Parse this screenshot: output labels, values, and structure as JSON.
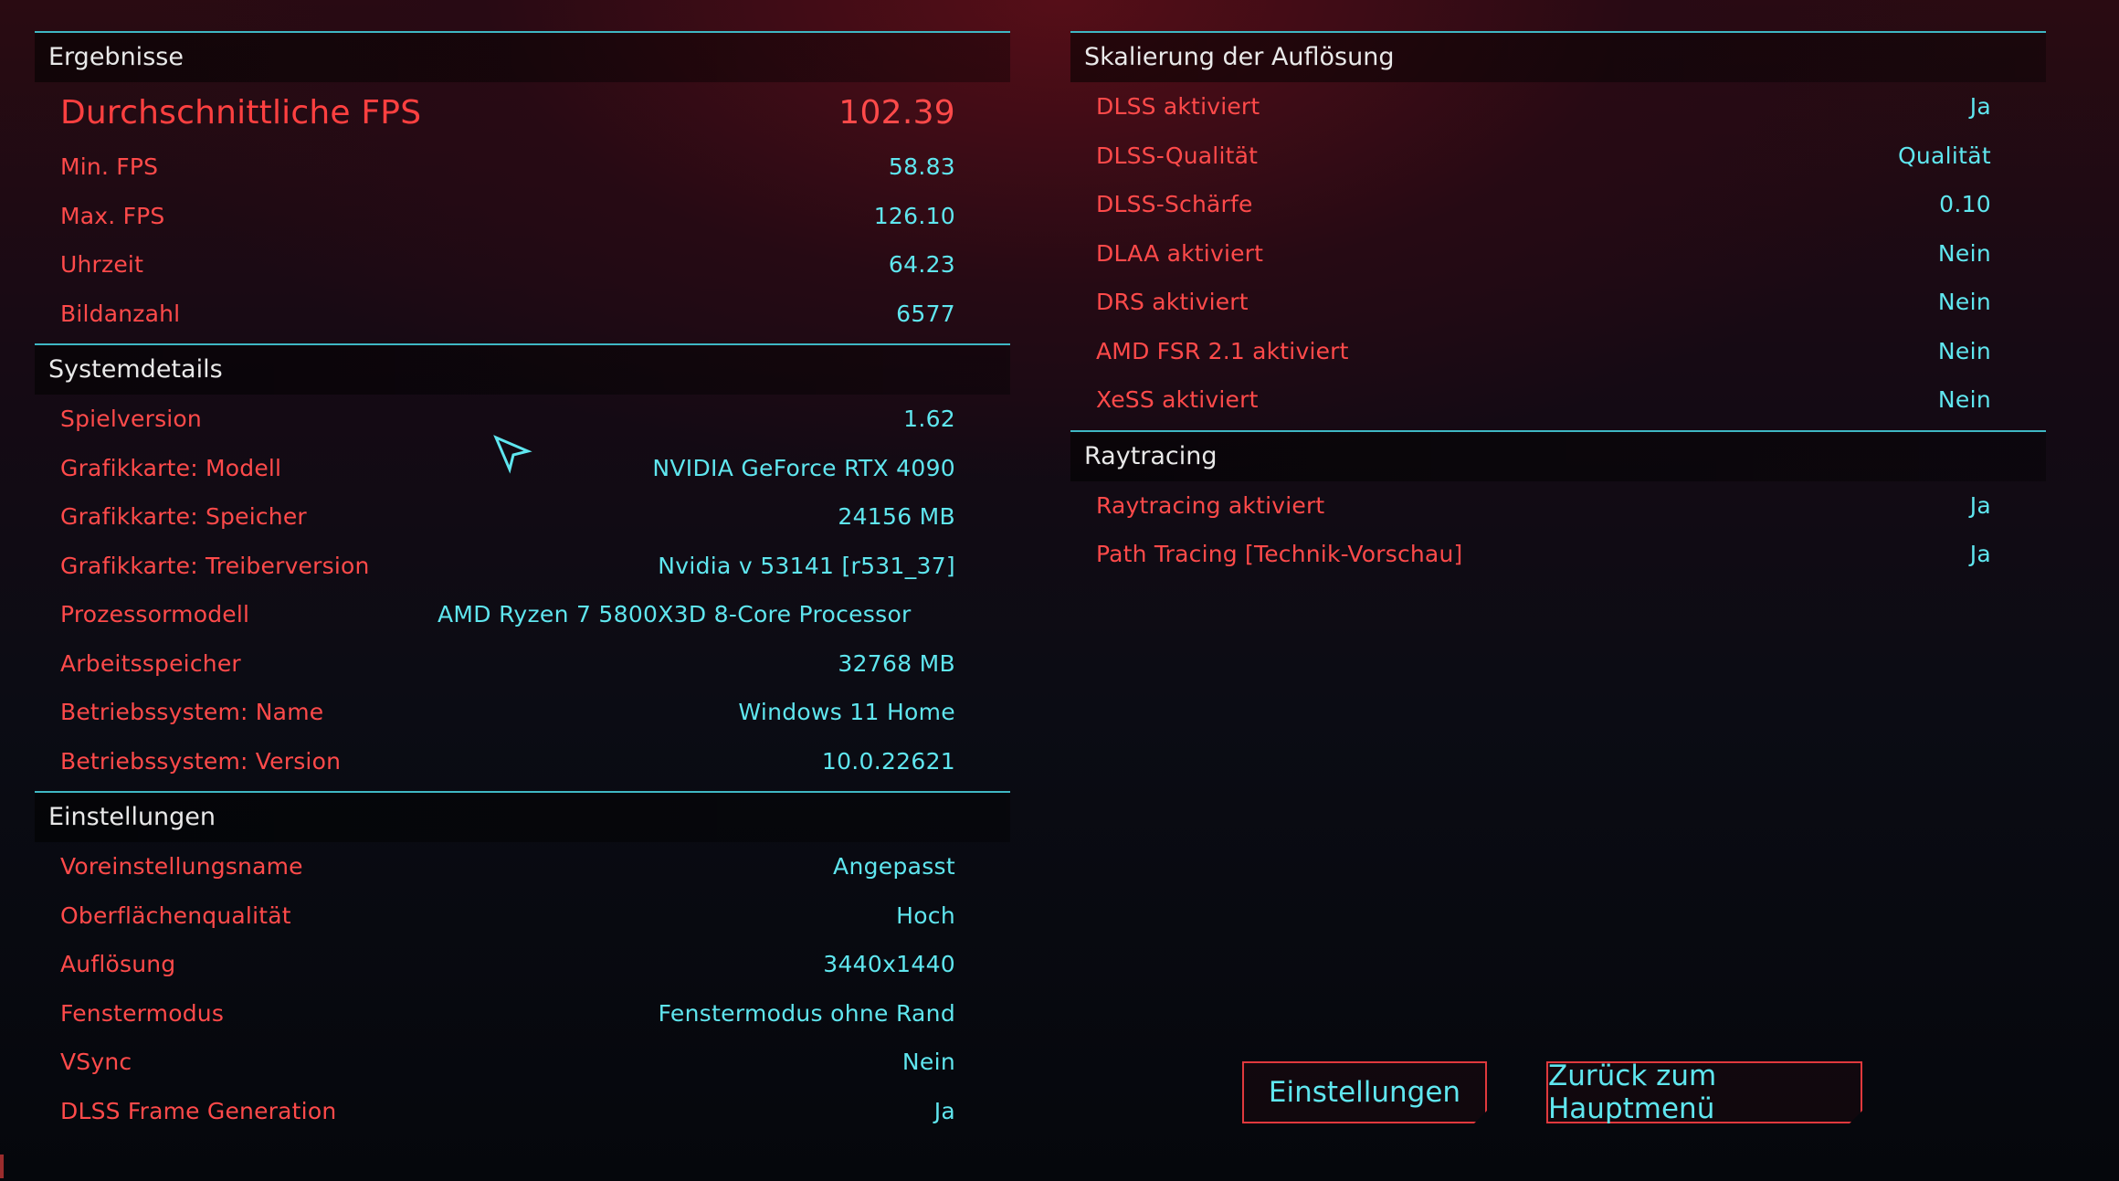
{
  "results": {
    "header": "Ergebnisse",
    "avg_fps": {
      "label": "Durchschnittliche FPS",
      "value": "102.39"
    },
    "rows": [
      {
        "label": "Min. FPS",
        "value": "58.83"
      },
      {
        "label": "Max. FPS",
        "value": "126.10"
      },
      {
        "label": "Uhrzeit",
        "value": "64.23"
      },
      {
        "label": "Bildanzahl",
        "value": "6577"
      }
    ]
  },
  "system": {
    "header": "Systemdetails",
    "rows": [
      {
        "label": "Spielversion",
        "value": "1.62"
      },
      {
        "label": "Grafikkarte: Modell",
        "value": "NVIDIA GeForce RTX 4090"
      },
      {
        "label": "Grafikkarte: Speicher",
        "value": "24156 MB"
      },
      {
        "label": "Grafikkarte: Treiberversion",
        "value": "Nvidia v 53141 [r531_37]"
      },
      {
        "label": "Prozessormodell",
        "value": "AMD Ryzen 7 5800X3D 8-Core Processor"
      },
      {
        "label": "Arbeitsspeicher",
        "value": "32768 MB"
      },
      {
        "label": "Betriebssystem: Name",
        "value": "Windows 11 Home"
      },
      {
        "label": "Betriebssystem: Version",
        "value": "10.0.22621"
      }
    ]
  },
  "settings": {
    "header": "Einstellungen",
    "rows": [
      {
        "label": "Voreinstellungsname",
        "value": "Angepasst"
      },
      {
        "label": "Oberflächenqualität",
        "value": "Hoch"
      },
      {
        "label": "Auflösung",
        "value": "3440x1440"
      },
      {
        "label": "Fenstermodus",
        "value": "Fenstermodus ohne Rand"
      },
      {
        "label": "VSync",
        "value": "Nein"
      },
      {
        "label": "DLSS Frame Generation",
        "value": "Ja"
      }
    ]
  },
  "scaling": {
    "header": "Skalierung der Auflösung",
    "rows": [
      {
        "label": "DLSS aktiviert",
        "value": "Ja"
      },
      {
        "label": "DLSS-Qualität",
        "value": "Qualität"
      },
      {
        "label": "DLSS-Schärfe",
        "value": "0.10"
      },
      {
        "label": "DLAA aktiviert",
        "value": "Nein"
      },
      {
        "label": "DRS aktiviert",
        "value": "Nein"
      },
      {
        "label": "AMD FSR 2.1 aktiviert",
        "value": "Nein"
      },
      {
        "label": "XeSS aktiviert",
        "value": "Nein"
      }
    ]
  },
  "raytracing": {
    "header": "Raytracing",
    "rows": [
      {
        "label": "Raytracing aktiviert",
        "value": "Ja"
      },
      {
        "label": "Path Tracing [Technik-Vorschau]",
        "value": "Ja"
      }
    ]
  },
  "buttons": {
    "settings": "Einstellungen",
    "back": "Zurück zum Hauptmenü"
  },
  "colors": {
    "label_red": "#ff4a4a",
    "value_cyan": "#5fe6ef",
    "divider_cyan": "#3fb7c4",
    "button_border": "#e0393d"
  }
}
